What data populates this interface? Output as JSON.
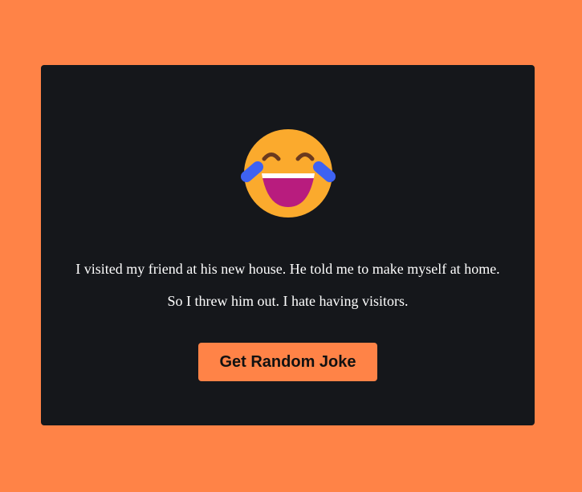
{
  "joke": {
    "emoji_icon": "face-with-tears-of-joy-icon",
    "setup": "I visited my friend at his new house. He told me to make myself at home.",
    "punchline": "So I threw him out. I hate having visitors."
  },
  "button": {
    "label": "Get Random Joke"
  },
  "colors": {
    "page_background": "#ff8347",
    "card_background": "#15171b",
    "button_background": "#ff8347",
    "text": "#ffffff",
    "button_text": "#111111"
  }
}
